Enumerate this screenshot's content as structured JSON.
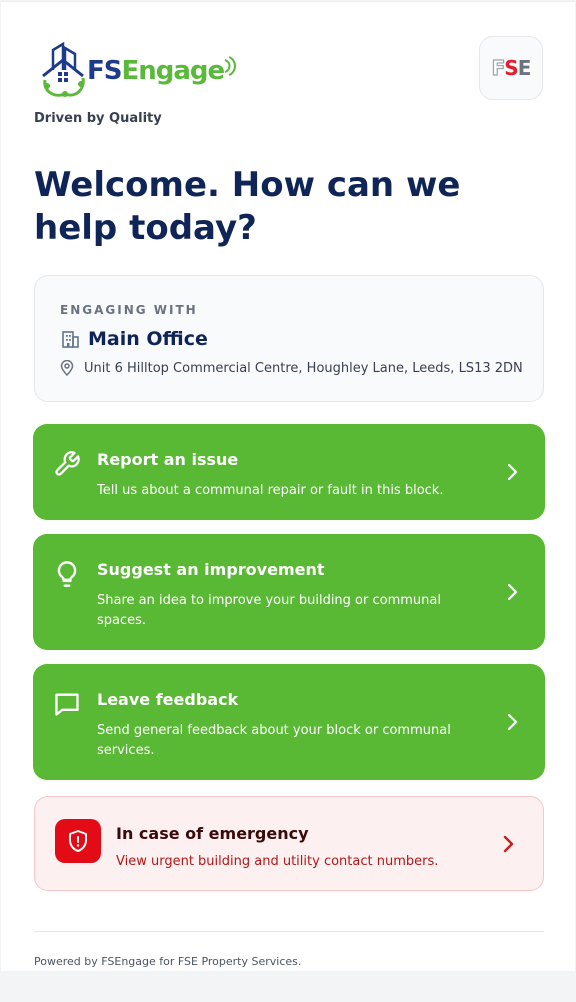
{
  "brand": {
    "logo_fs": "FS",
    "logo_engage": "Engage",
    "tagline": "Driven by Quality",
    "badge_f": "F",
    "badge_s": "S",
    "badge_e": "E",
    "navy": "#0f2558",
    "green": "#59b935",
    "red": "#e30b16"
  },
  "heading": "Welcome. How can we help today?",
  "engaging": {
    "label": "ENGAGING WITH",
    "site_name": "Main Office",
    "site_icon": "building-icon",
    "address_icon": "map-pin-icon",
    "address": "Unit 6 Hilltop Commercial Centre, Houghley Lane, Leeds, LS13 2DN"
  },
  "actions": [
    {
      "icon": "wrench-icon",
      "title": "Report an issue",
      "description": "Tell us about a communal repair or fault in this block."
    },
    {
      "icon": "lightbulb-icon",
      "title": "Suggest an improvement",
      "description": "Share an idea to improve your building or communal spaces."
    },
    {
      "icon": "message-icon",
      "title": "Leave feedback",
      "description": "Send general feedback about your block or communal services."
    }
  ],
  "emergency": {
    "icon": "shield-alert-icon",
    "title": "In case of emergency",
    "description": "View urgent building and utility contact numbers."
  },
  "footer": "Powered by FSEngage for FSE Property Services."
}
